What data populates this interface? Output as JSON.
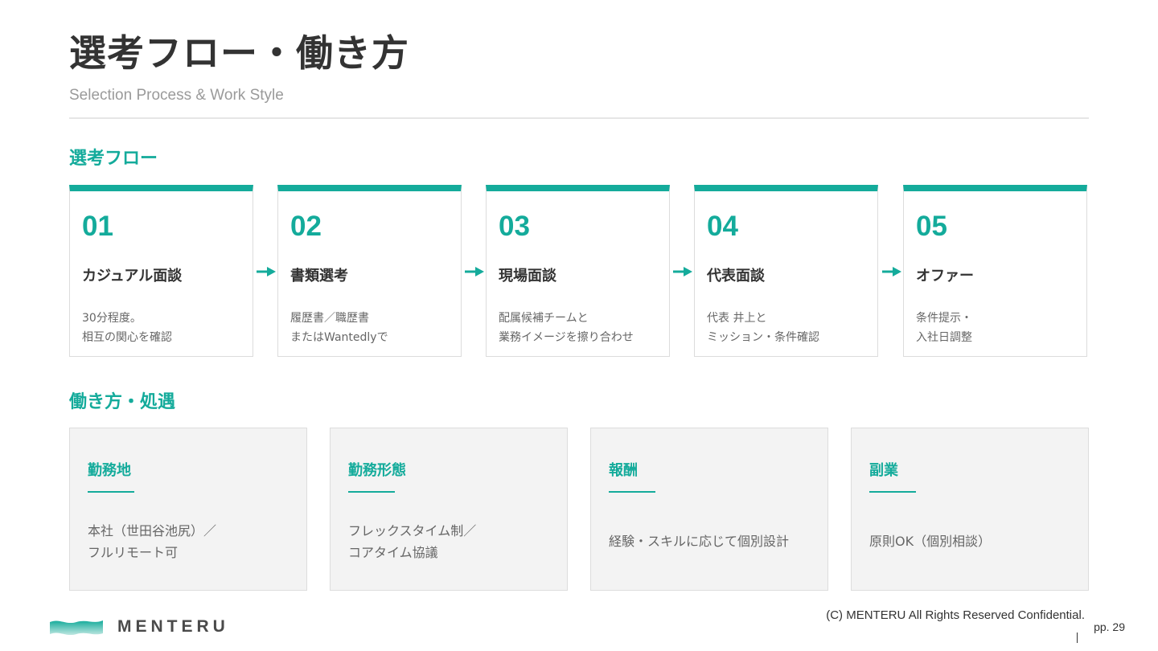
{
  "header": {
    "title": "選考フロー・働き方",
    "subtitle": "Selection Process & Work Style"
  },
  "colors": {
    "accent": "#14ab9b",
    "text": "#333333",
    "muted": "#666666",
    "card_bg": "#f3f3f3"
  },
  "flow": {
    "title": "選考フロー",
    "steps": [
      {
        "num": "01",
        "name": "カジュアル面談",
        "desc": [
          "30分程度。",
          "相互の関心を確認"
        ]
      },
      {
        "num": "02",
        "name": "書類選考",
        "desc": [
          "履歴書／職歴書",
          "またはWantedlyで"
        ]
      },
      {
        "num": "03",
        "name": "現場面談",
        "desc": [
          "配属候補チームと",
          "業務イメージを擦り合わせ"
        ]
      },
      {
        "num": "04",
        "name": "代表面談",
        "desc": [
          "代表 井上と",
          "ミッション・条件確認"
        ]
      },
      {
        "num": "05",
        "name": "オファー",
        "desc": [
          "条件提示・",
          "入社日調整"
        ]
      }
    ],
    "arrow_icon": "arrow-right-icon"
  },
  "work": {
    "title": "働き方・処遇",
    "cards": [
      {
        "title": "勤務地",
        "body": [
          "本社（世田谷池尻）／",
          "フルリモート可"
        ]
      },
      {
        "title": "勤務形態",
        "body": [
          "フレックスタイム制／",
          "コアタイム協議"
        ]
      },
      {
        "title": "報酬",
        "body": [
          "経験・スキルに応じて個別設計"
        ]
      },
      {
        "title": "副業",
        "body": [
          "原則OK（個別相談）"
        ]
      }
    ]
  },
  "footer": {
    "logo_text": "MENTERU",
    "logo_icon": "menteru-wave-logo-icon",
    "copyright": "(C) MENTERU All Rights Reserved Confidential.",
    "page": "pp. 29"
  }
}
